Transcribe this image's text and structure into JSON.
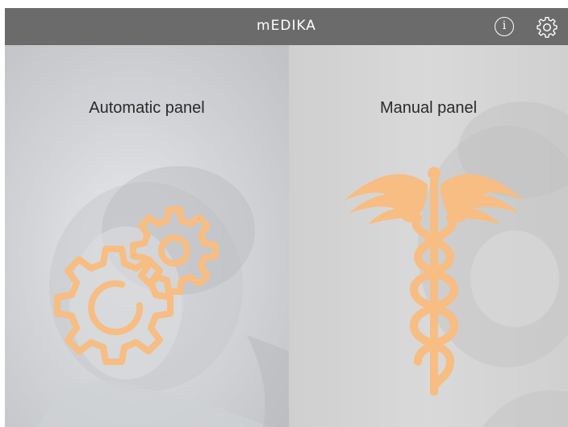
{
  "header": {
    "logo_text": "mEDIKA",
    "info_icon": "info-icon",
    "info_glyph": "i",
    "settings_icon": "gear-icon"
  },
  "panels": [
    {
      "label": "Automatic panel",
      "icon": "gears-icon"
    },
    {
      "label": "Manual panel",
      "icon": "caduceus-icon"
    }
  ],
  "colors": {
    "header_bg": "#6b6b6b",
    "icon_accent": "#f7bd82",
    "auto_panel_bg": "#d3d5d8",
    "manual_panel_bg": "#d4d4d4"
  }
}
